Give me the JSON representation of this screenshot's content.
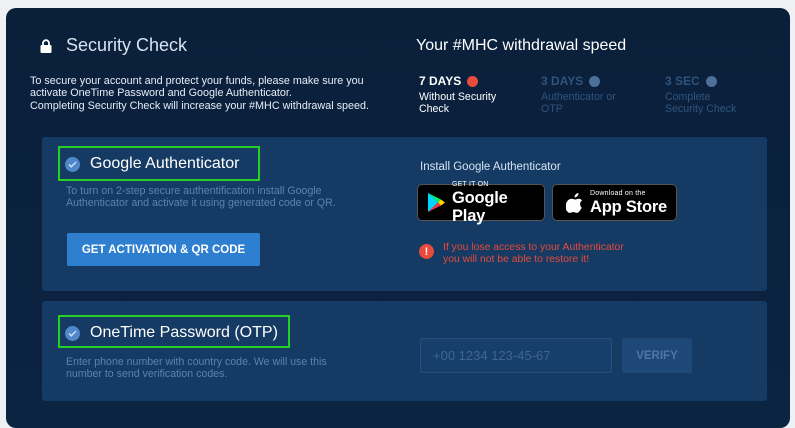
{
  "header": {
    "title": "Security Check",
    "intro_lines": [
      "To secure your account and protect your funds, please make sure you",
      "activate OneTime Password and Google Authenticator.",
      "Completing Security Check will increase your #MHC withdrawal speed."
    ]
  },
  "speed": {
    "title": "Your #MHC withdrawal speed",
    "levels": [
      {
        "label": "7 DAYS",
        "desc_lines": [
          "Without Security",
          "Check"
        ],
        "active": true
      },
      {
        "label": "3 DAYS",
        "desc_lines": [
          "Authenticator or",
          "OTP"
        ],
        "active": false
      },
      {
        "label": "3 SEC",
        "desc_lines": [
          "Complete",
          "Security Check"
        ],
        "active": false
      }
    ]
  },
  "google_auth": {
    "title": "Google Authenticator",
    "desc_lines": [
      "To turn on 2-step secure authentification install Google",
      "Authenticator and activate it using generated code or QR."
    ],
    "button_label": "GET ACTIVATION & QR CODE",
    "install_label": "Install Google Authenticator",
    "google_play": {
      "small": "GET IT ON",
      "big": "Google Play"
    },
    "app_store": {
      "small": "Download on the",
      "big": "App Store"
    },
    "warning_lines": [
      "If you lose access to your Authenticator",
      "you will not be able to restore it!"
    ]
  },
  "otp": {
    "title": "OneTime Password (OTP)",
    "desc_lines": [
      "Enter phone number with country code. We will use this",
      "number to send verification codes."
    ],
    "placeholder": "+00 1234 123-45-67",
    "verify_label": "VERIFY"
  },
  "colors": {
    "background": "#0a1f3a",
    "card": "#153a63",
    "accent": "#2f7fd0",
    "alert": "#e84a3b",
    "highlight": "#22d123"
  },
  "icons": [
    "lock-icon",
    "check-circle-icon",
    "google-play-icon",
    "apple-icon",
    "alert-icon"
  ]
}
